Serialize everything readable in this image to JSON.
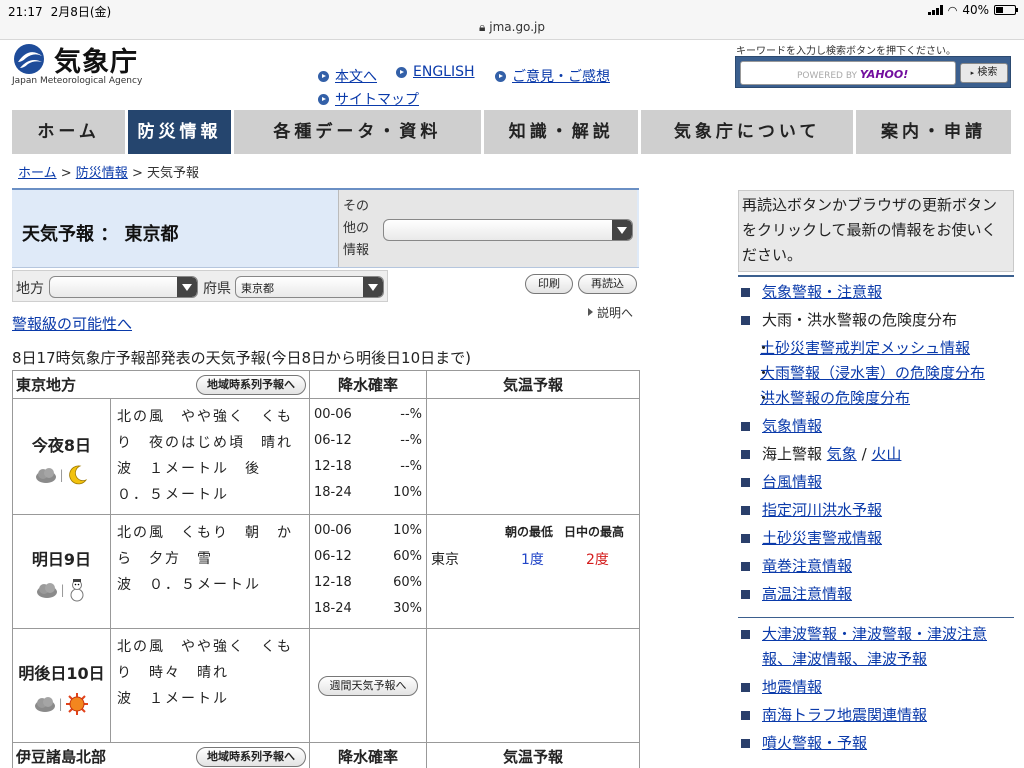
{
  "status": {
    "time": "21:17",
    "date": "2月8日(金)",
    "url": "jma.go.jp",
    "battery": "40%",
    "battery_level": 0.4
  },
  "header": {
    "logo_ja": "気象庁",
    "logo_en": "Japan Meteorological Agency",
    "links": [
      "本文へ",
      "ENGLISH",
      "ご意見・ご感想",
      "サイトマップ"
    ],
    "search_hint": "キーワードを入力し検索ボタンを押下ください。",
    "search_powered": "POWERED BY",
    "search_brand": "YAHOO!",
    "search_button": "検索"
  },
  "nav": [
    "ホーム",
    "防災情報",
    "各種データ・資料",
    "知識・解説",
    "気象庁について",
    "案内・申請"
  ],
  "breadcrumb": {
    "home": "ホーム",
    "sep": " > ",
    "disaster": "防災情報",
    "current": "天気予報"
  },
  "title": "天気予報 ： 東京都",
  "other": {
    "label": "その他の情報",
    "value": ""
  },
  "region": {
    "label_region": "地方",
    "region_value": "",
    "label_pref": "府県",
    "pref_value": "東京都"
  },
  "buttons": {
    "print": "印刷",
    "reload": "再読込",
    "explain": "説明へ",
    "timeseries": "地域時系列予報へ",
    "weekly": "週間天気予報へ"
  },
  "warning_link": "警報級の可能性へ",
  "announcement": "8日17時気象庁予報部発表の天気予報(今日8日から明後日10日まで)",
  "forecast": {
    "col_pop": "降水確率",
    "col_temp": "気温予報",
    "temp_min_label": "朝の最低",
    "temp_max_label": "日中の最高",
    "areas": [
      {
        "name": "東京地方",
        "days": [
          {
            "label": "今夜8日",
            "desc": [
              "北の風　やや強く　くも",
              "り　夜のはじめ頃　晴れ",
              "波　１メートル　後",
              "０．５メートル"
            ],
            "pop": [
              [
                "00-06",
                "--%"
              ],
              [
                "06-12",
                "--%"
              ],
              [
                "12-18",
                "--%"
              ],
              [
                "18-24",
                "10%"
              ]
            ],
            "icons": [
              "cloud-icon",
              "moon-icon"
            ]
          },
          {
            "label": "明日9日",
            "desc": [
              "北の風　くもり　朝　か",
              "ら　夕方　雪",
              "波　０．５メートル"
            ],
            "pop": [
              [
                "00-06",
                "10%"
              ],
              [
                "06-12",
                "60%"
              ],
              [
                "12-18",
                "60%"
              ],
              [
                "18-24",
                "30%"
              ]
            ],
            "temp_city": "東京",
            "temp_min": "1度",
            "temp_max": "2度",
            "icons": [
              "cloud-icon",
              "snowman-icon"
            ]
          },
          {
            "label": "明後日10日",
            "desc": [
              "北の風　やや強く　くも",
              "り　時々　晴れ",
              "波　１メートル"
            ],
            "icons": [
              "cloud-icon",
              "sun-icon"
            ]
          }
        ]
      },
      {
        "name": "伊豆諸島北部"
      }
    ]
  },
  "side": {
    "notice": "再読込ボタンかブラウザの更新ボタンをクリックして最新の情報をお使いください。",
    "list1": [
      {
        "type": "link",
        "text": "気象警報・注意報"
      },
      {
        "type": "text",
        "text": "大雨・洪水警報の危険度分布"
      },
      {
        "type": "sublink",
        "text": "土砂災害警戒判定メッシュ情報"
      },
      {
        "type": "sublink",
        "text": "大雨警報（浸水害）の危険度分布"
      },
      {
        "type": "sublink",
        "text": "洪水警報の危険度分布"
      },
      {
        "type": "link",
        "text": "気象情報"
      },
      {
        "type": "marine",
        "text": "海上警報",
        "a": "気象",
        "sep": " / ",
        "b": "火山"
      },
      {
        "type": "link",
        "text": "台風情報"
      },
      {
        "type": "link",
        "text": "指定河川洪水予報"
      },
      {
        "type": "link",
        "text": "土砂災害警戒情報"
      },
      {
        "type": "link",
        "text": "竜巻注意情報"
      },
      {
        "type": "link",
        "text": "高温注意情報"
      }
    ],
    "list2": [
      {
        "type": "link",
        "text": "大津波警報・津波警報・津波注意報、津波情報、津波予報"
      },
      {
        "type": "link",
        "text": "地震情報"
      },
      {
        "type": "link",
        "text": "南海トラフ地震関連情報"
      },
      {
        "type": "link",
        "text": "噴火警報・予報"
      }
    ]
  }
}
